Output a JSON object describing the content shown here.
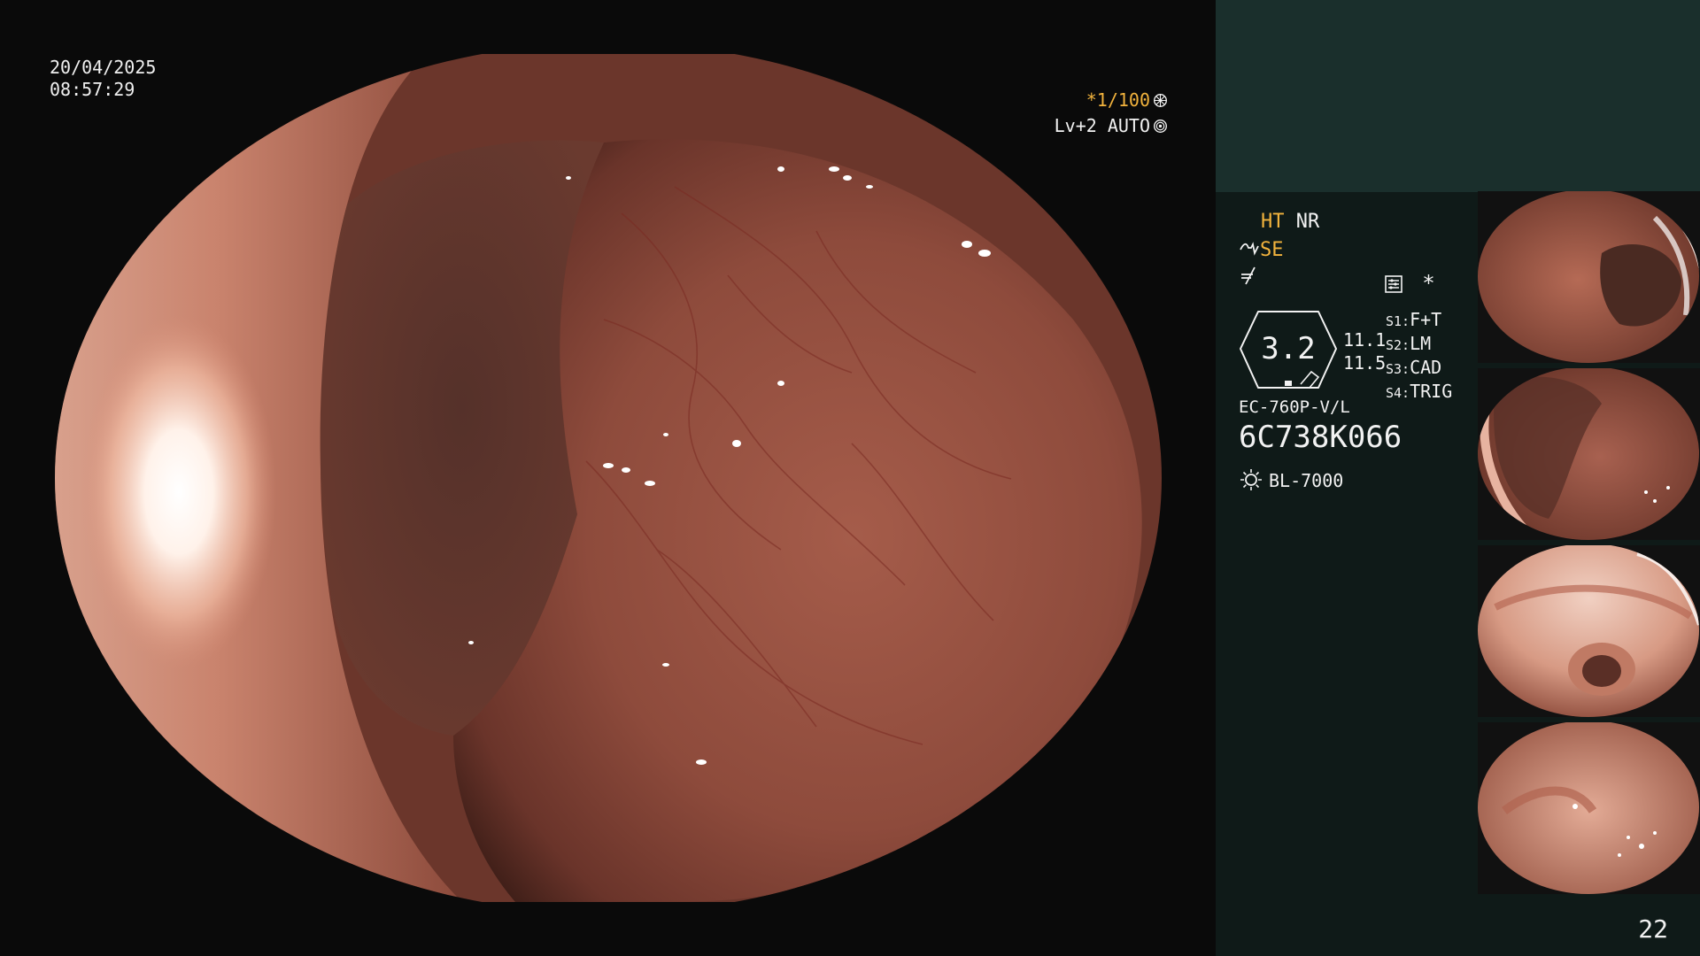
{
  "main": {
    "date": "20/04/2025",
    "time": "08:57:29",
    "shutter_speed": "*1/100",
    "enhancement": "Lv+2",
    "iris_mode": "AUTO"
  },
  "icons": {
    "shutter": "shutter-wheel-icon",
    "iris": "iris-target-icon",
    "sharpness": "sharpness-icon",
    "filter": "filter-slash-icon",
    "settings_menu": "settings-menu-icon",
    "asterisk": "asterisk-icon",
    "light_source": "light-bulb-icon"
  },
  "panel": {
    "mode_ht": "HT",
    "mode_nr": "NR",
    "mode_se": "SE",
    "asterisk": "*",
    "zoom_value": "3.2",
    "zoom_top": "11.1",
    "zoom_bottom": "11.5",
    "scope_settings": [
      {
        "label": "S1:",
        "value": "F+T"
      },
      {
        "label": "S2:",
        "value": "LM"
      },
      {
        "label": "S3:",
        "value": "CAD"
      },
      {
        "label": "S4:",
        "value": "TRIG"
      }
    ],
    "scope_model": "EC-760P-V/L",
    "scope_serial": "6C738K066",
    "light_source": "BL-7000",
    "page_number": "22"
  },
  "colors": {
    "amber": "#f2b33d",
    "panel_background": "#0f1a18",
    "panel_header": "#1a2f2c",
    "main_background": "#0a0a0a"
  }
}
